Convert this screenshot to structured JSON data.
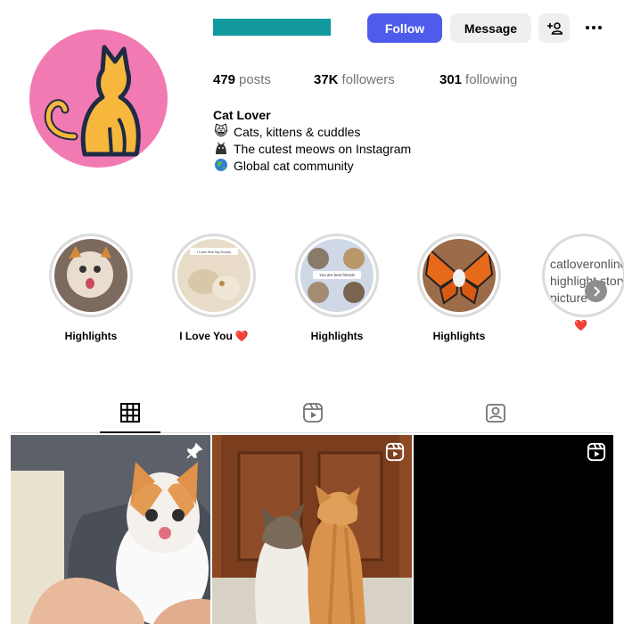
{
  "header": {
    "follow_label": "Follow",
    "message_label": "Message",
    "add_user_icon": "person-add-icon",
    "more_icon": "more-horizontal-icon"
  },
  "stats": {
    "posts_count": "479",
    "posts_label": "posts",
    "followers_count": "37K",
    "followers_label": "followers",
    "following_count": "301",
    "following_label": "following"
  },
  "bio": {
    "name": "Cat Lover",
    "lines": [
      {
        "emoji": "😸",
        "text": "Cats, kittens & cuddles"
      },
      {
        "emoji": "🐈‍⬛",
        "text": "The cutest meows on Instagram"
      },
      {
        "emoji": "🌎",
        "text": "Global cat community"
      }
    ]
  },
  "highlights": [
    {
      "label": "Highlights",
      "heart": ""
    },
    {
      "label": "I Love You",
      "heart": "❤️"
    },
    {
      "label": "Highlights",
      "heart": ""
    },
    {
      "label": "Highlights",
      "heart": ""
    },
    {
      "label": "",
      "heart": "❤️",
      "broken_alt": "catloveronline\nhighlight story\npicture"
    }
  ],
  "highlight_captions": {
    "love": "I Love See My Honey",
    "best": "You are best friends"
  },
  "tabs": [
    {
      "name": "posts",
      "icon": "grid-icon",
      "active": true
    },
    {
      "name": "reels",
      "icon": "reels-icon",
      "active": false
    },
    {
      "name": "tagged",
      "icon": "tagged-icon",
      "active": false
    }
  ],
  "colors": {
    "accent": "#4f5bea",
    "avatar_bg": "#f27ab2",
    "username_bar": "#11999e",
    "cat": "#f6b73c"
  }
}
